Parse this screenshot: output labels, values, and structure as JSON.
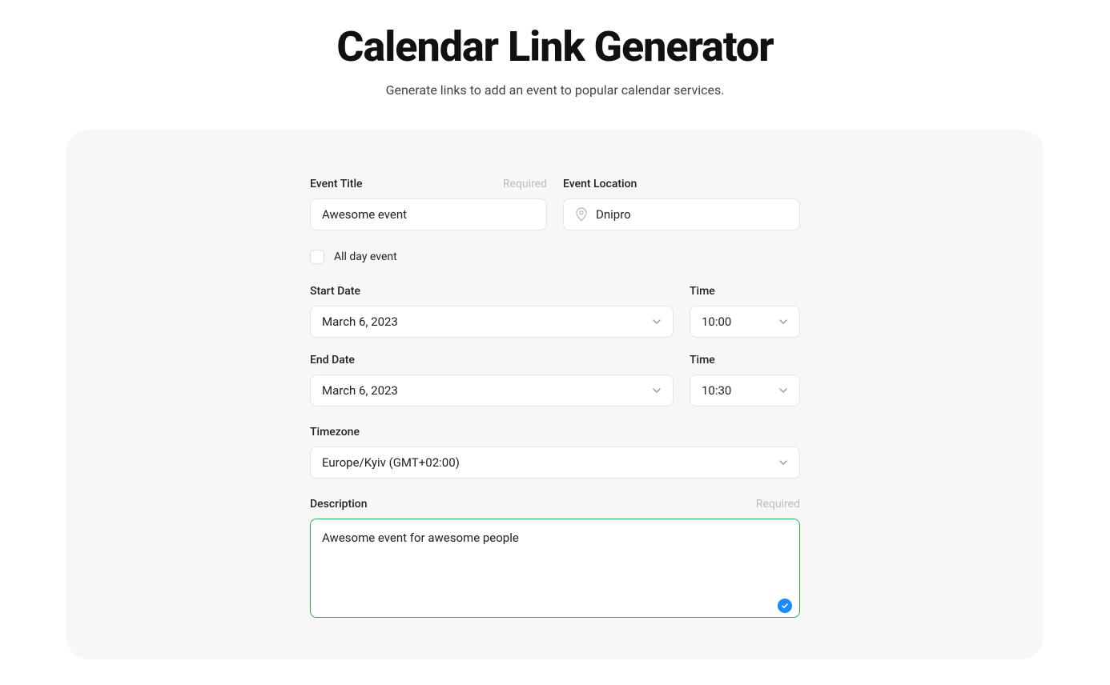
{
  "header": {
    "title": "Calendar Link Generator",
    "subtitle": "Generate links to add an event to popular calendar services."
  },
  "form": {
    "title": {
      "label": "Event Title",
      "required_text": "Required",
      "value": "Awesome event"
    },
    "location": {
      "label": "Event Location",
      "value": "Dnipro"
    },
    "all_day": {
      "label": "All day event",
      "checked": false
    },
    "start_date": {
      "label": "Start Date",
      "value": "March 6, 2023"
    },
    "start_time": {
      "label": "Time",
      "value": "10:00"
    },
    "end_date": {
      "label": "End Date",
      "value": "March 6, 2023"
    },
    "end_time": {
      "label": "Time",
      "value": "10:30"
    },
    "timezone": {
      "label": "Timezone",
      "value": "Europe/Kyiv (GMT+02:00)"
    },
    "description": {
      "label": "Description",
      "required_text": "Required",
      "value": "Awesome event for awesome people"
    }
  }
}
